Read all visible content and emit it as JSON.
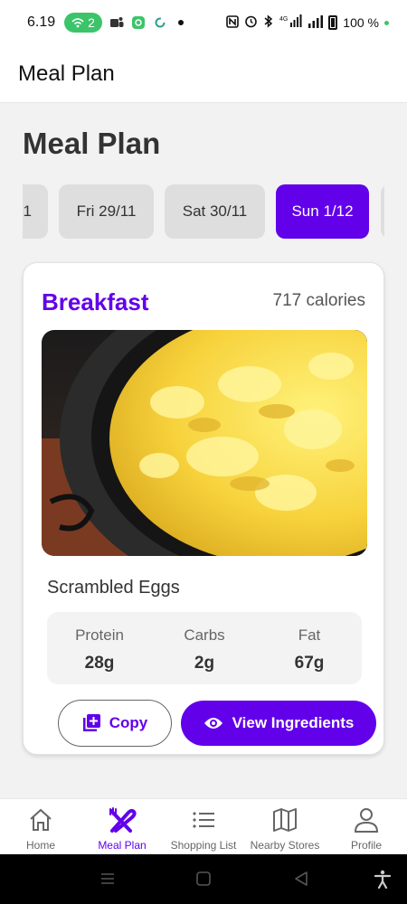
{
  "status_bar": {
    "time": "6.19",
    "hotspot_count": "2",
    "network_label": "4G",
    "battery_percent": "100 %"
  },
  "app_bar": {
    "title": "Meal Plan"
  },
  "page": {
    "title": "Meal Plan"
  },
  "dates": [
    {
      "label": "1",
      "active": false
    },
    {
      "label": "Fri 29/11",
      "active": false
    },
    {
      "label": "Sat 30/11",
      "active": false
    },
    {
      "label": "Sun 1/12",
      "active": true
    },
    {
      "label": "",
      "active": false
    }
  ],
  "meal": {
    "type": "Breakfast",
    "calories": "717 calories",
    "name": "Scrambled Eggs",
    "macros": [
      {
        "label": "Protein",
        "value": "28g"
      },
      {
        "label": "Carbs",
        "value": "2g"
      },
      {
        "label": "Fat",
        "value": "67g"
      }
    ],
    "copy_label": "Copy",
    "view_label": "View Ingredients"
  },
  "bottom_nav": [
    {
      "label": "Home",
      "icon": "home-icon",
      "active": false
    },
    {
      "label": "Meal Plan",
      "icon": "utensils-icon",
      "active": true
    },
    {
      "label": "Shopping List",
      "icon": "list-icon",
      "active": false
    },
    {
      "label": "Nearby Stores",
      "icon": "map-icon",
      "active": false
    },
    {
      "label": "Profile",
      "icon": "person-icon",
      "active": false
    }
  ],
  "colors": {
    "accent": "#6200ea",
    "chip": "#dedede",
    "status_green": "#3cc46a"
  }
}
